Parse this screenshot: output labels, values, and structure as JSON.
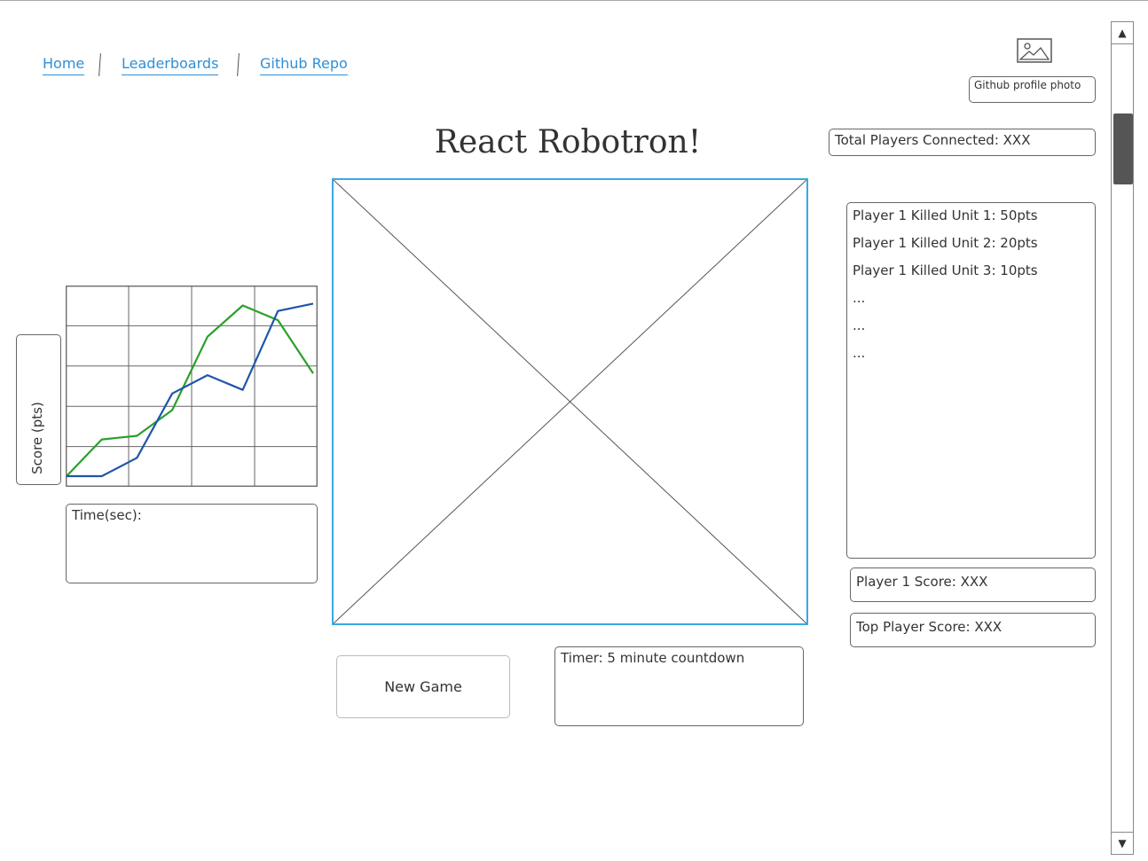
{
  "nav": {
    "links": [
      "Home",
      "Leaderboards",
      "Github Repo"
    ]
  },
  "header": {
    "title": "React Robotron!"
  },
  "profile": {
    "photo_label": "Github profile photo",
    "icon": "image-icon"
  },
  "stats": {
    "total_players": "Total Players Connected: XXX",
    "player1_score": "Player 1 Score: XXX",
    "top_score": "Top Player Score: XXX"
  },
  "kill_log": [
    "Player 1 Killed Unit 1: 50pts",
    "Player 1 Killed Unit 2: 20pts",
    "Player 1 Killed Unit 3: 10pts",
    "...",
    "...",
    "..."
  ],
  "controls": {
    "new_game": "New Game",
    "timer": "Timer: 5 minute countdown"
  },
  "colors": {
    "link": "#2f8fd6",
    "canvas_border": "#3aa8e6",
    "series_green": "#2aa02a",
    "series_blue": "#1f56a8"
  },
  "chart_data": {
    "type": "line",
    "title": "",
    "xlabel": "Time(sec):",
    "ylabel": "Score (pts)",
    "grid": true,
    "x": [
      0,
      1,
      2,
      3,
      4,
      5,
      6,
      7
    ],
    "xlim": [
      0,
      7
    ],
    "ylim": [
      0,
      10
    ],
    "series": [
      {
        "color": "#2aa02a",
        "values": [
          0,
          2.0,
          2.2,
          3.6,
          7.6,
          9.3,
          8.5,
          5.6
        ]
      },
      {
        "color": "#1f56a8",
        "values": [
          0,
          0,
          1.0,
          4.5,
          5.5,
          4.7,
          9.0,
          9.4
        ]
      }
    ]
  }
}
